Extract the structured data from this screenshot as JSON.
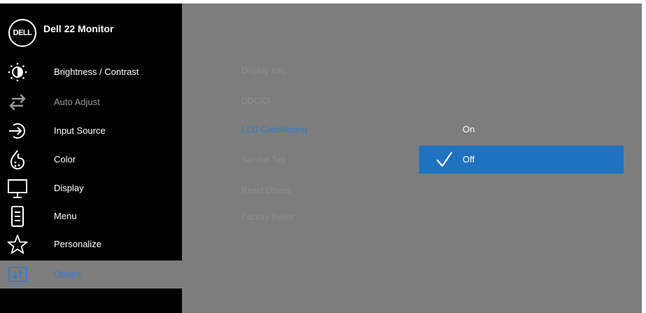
{
  "header": {
    "logo_text": "DELL",
    "title": "Dell 22 Monitor"
  },
  "menu": [
    {
      "label": "Brightness / Contrast",
      "icon": "brightness-icon"
    },
    {
      "label": "Auto Adjust",
      "icon": "auto-adjust-icon"
    },
    {
      "label": "Input Source",
      "icon": "input-source-icon"
    },
    {
      "label": "Color",
      "icon": "color-palette-icon"
    },
    {
      "label": "Display",
      "icon": "display-monitor-icon"
    },
    {
      "label": "Menu",
      "icon": "menu-document-icon"
    },
    {
      "label": "Personalize",
      "icon": "star-icon"
    },
    {
      "label": "Others",
      "icon": "others-icon"
    }
  ],
  "submenu": [
    {
      "label": "Display Info"
    },
    {
      "label": "DDC/CI"
    },
    {
      "label": "LCD Conditioning"
    },
    {
      "label": "Service Tag"
    },
    {
      "label": "Reset Others"
    },
    {
      "label": "Factory Reset"
    }
  ],
  "options": [
    {
      "label": "On"
    },
    {
      "label": "Off"
    }
  ],
  "colors": {
    "sidebar_bg": "#000000",
    "panel_bg": "#7d7d7d",
    "accent": "#1e72c0",
    "selected_text": "#2e7fd2"
  }
}
